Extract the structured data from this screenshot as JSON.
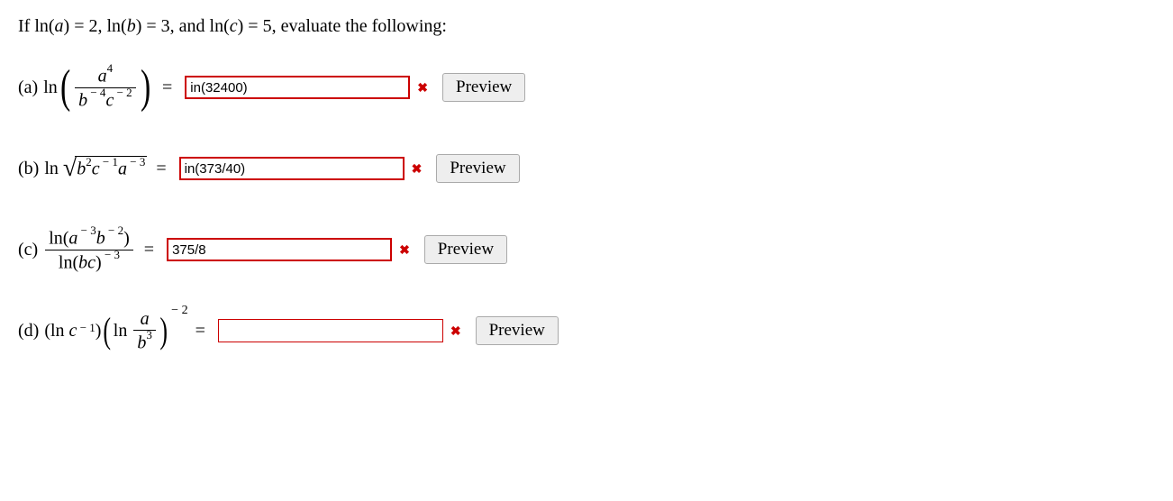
{
  "prompt": "If ln(a) = 2, ln(b) = 3, and ln(c) = 5, evaluate the following:",
  "rows": {
    "a": {
      "label": "(a)",
      "value": "in(32400)",
      "mark": "✖",
      "preview": "Preview"
    },
    "b": {
      "label": "(b)",
      "value": "in(373/40)",
      "mark": "✖",
      "preview": "Preview"
    },
    "c": {
      "label": "(c)",
      "value": "375/8",
      "mark": "✖",
      "preview": "Preview"
    },
    "d": {
      "label": "(d)",
      "value": "",
      "mark": "✖",
      "preview": "Preview"
    }
  },
  "eq": "="
}
